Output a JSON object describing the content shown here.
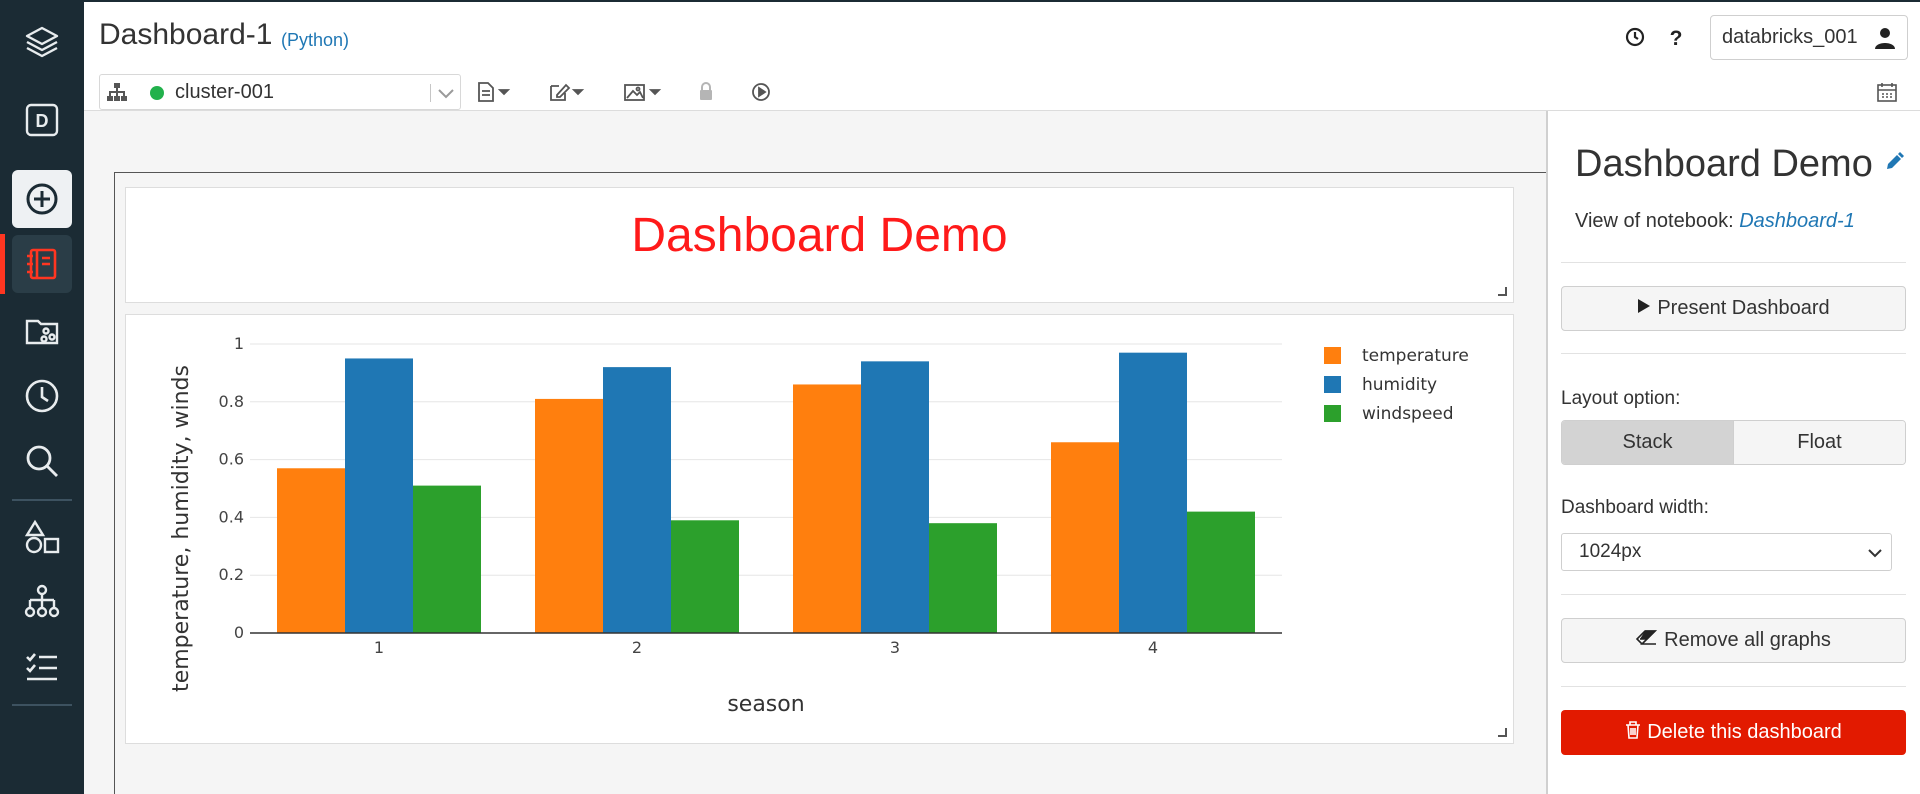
{
  "notebook": {
    "title": "Dashboard-1",
    "language": "(Python)"
  },
  "user": {
    "name": "databricks_001"
  },
  "cluster": {
    "name": "cluster-001",
    "status_color": "#22b14c"
  },
  "sidebar": {
    "items": [
      {
        "icon": "layers-logo-icon"
      },
      {
        "icon": "workspace-d-icon"
      },
      {
        "icon": "create-plus-icon"
      },
      {
        "icon": "notebook-icon",
        "active": true
      },
      {
        "icon": "repos-icon"
      },
      {
        "icon": "recents-clock-icon"
      },
      {
        "icon": "search-icon"
      },
      {
        "icon": "shapes-icon"
      },
      {
        "icon": "cluster-tree-icon"
      },
      {
        "icon": "jobs-checklist-icon"
      }
    ],
    "active_color": "#ff3621"
  },
  "toolbar": {
    "icons": [
      "file-menu-icon",
      "edit-menu-icon",
      "view-menu-icon",
      "lock-icon",
      "run-all-icon",
      "schedule-calendar-icon"
    ]
  },
  "dashboard": {
    "heading": "Dashboard Demo",
    "heading_color": "#ff1a1a"
  },
  "chart_data": {
    "type": "bar",
    "categories": [
      "1",
      "2",
      "3",
      "4"
    ],
    "series": [
      {
        "name": "temperature",
        "values": [
          0.57,
          0.81,
          0.86,
          0.66
        ],
        "color": "#ff7f0e"
      },
      {
        "name": "humidity",
        "values": [
          0.95,
          0.92,
          0.94,
          0.97
        ],
        "color": "#1f77b4"
      },
      {
        "name": "windspeed",
        "values": [
          0.51,
          0.39,
          0.38,
          0.42
        ],
        "color": "#2ca02c"
      }
    ],
    "xlabel": "season",
    "ylabel": "temperature, humidity, winds",
    "ylim": [
      0,
      1
    ],
    "yticks": [
      "0",
      "0.2",
      "0.4",
      "0.6",
      "0.8",
      "1"
    ],
    "grid": true,
    "legend": "top-right"
  },
  "panel": {
    "title": "Dashboard Demo",
    "view_of_label": "View of notebook:",
    "view_of_link": "Dashboard-1",
    "present_label": "Present Dashboard",
    "layout_label": "Layout option:",
    "layout_options": [
      "Stack",
      "Float"
    ],
    "layout_selected": "Stack",
    "width_label": "Dashboard width:",
    "width_value": "1024px",
    "remove_label": "Remove all graphs",
    "delete_label": "Delete this dashboard",
    "delete_color": "#e21a00",
    "link_color": "#1f77b4"
  }
}
